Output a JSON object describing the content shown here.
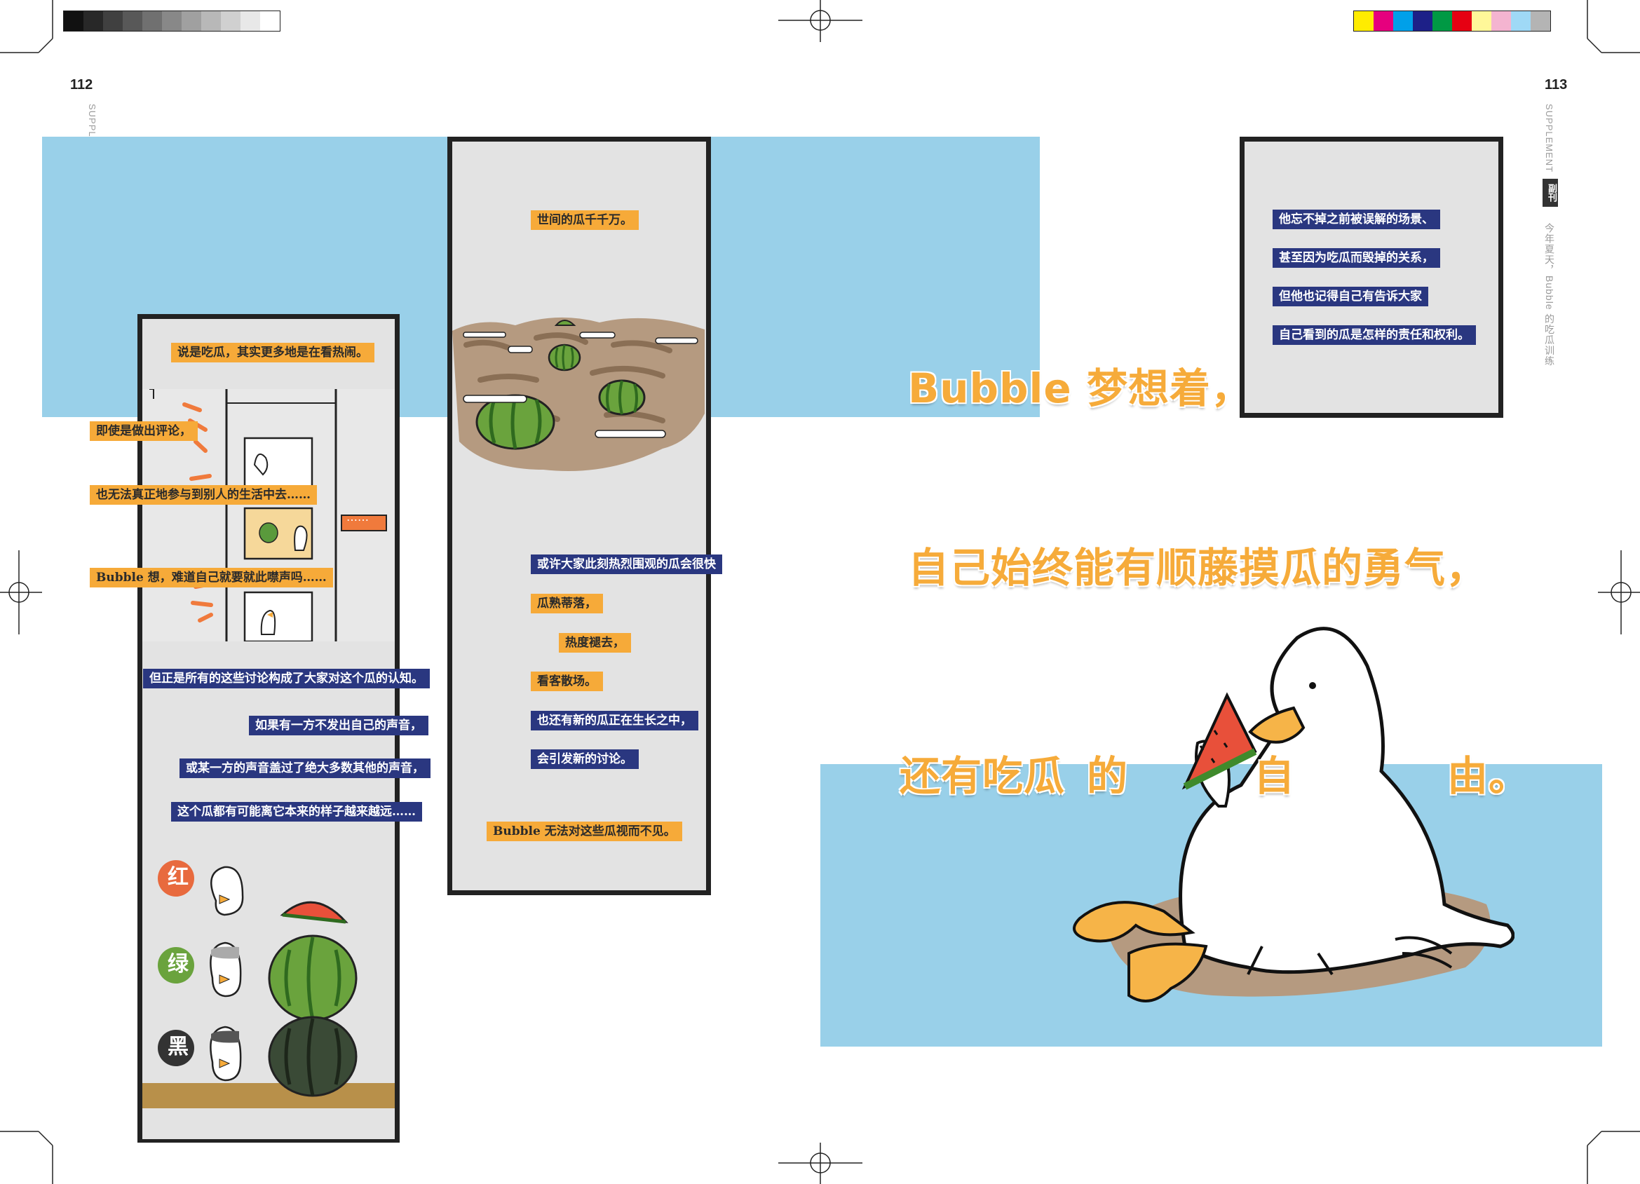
{
  "pages": {
    "left_number": "112",
    "right_number": "113"
  },
  "sidebar": {
    "supplement": "SUPPLEMENT",
    "seal": "副刊",
    "subtitle": "今年夏天，Bubble 的吃瓜训练"
  },
  "colors": {
    "sky": "#99d0e9",
    "orange_label": "#f6aa39",
    "navy_label": "#2a3780",
    "panel_bg": "#e3e3e3",
    "panel_border": "#222222",
    "headline": "#f6ab3a",
    "left_greys": [
      "#111111",
      "#282828",
      "#404040",
      "#585858",
      "#707070",
      "#888888",
      "#a0a0a0",
      "#b8b8b8",
      "#d0d0d0",
      "#e8e8e8",
      "#ffffff"
    ],
    "right_swatches": [
      "#ffec00",
      "#e6007e",
      "#00a0e9",
      "#1d2088",
      "#009944",
      "#e60012",
      "#fff799",
      "#f4b4d0",
      "#9fd9f6",
      "#b4b4b4"
    ]
  },
  "panel1": {
    "labels": [
      "说是吃瓜，其实更多地是在看热闹。",
      "即使是做出评论，",
      "也无法真正地参与到别人的生活中去……",
      "Bubble 想，难道自己就要就此噤声吗……",
      "但正是所有的这些讨论构成了大家对这个瓜的认知。",
      "如果有一方不发出自己的声音，",
      "或某一方的声音盖过了绝大多数其他的声音，",
      "这个瓜都有可能离它本来的样子越来越远……"
    ],
    "speech_bubble": "……",
    "badges": [
      "红",
      "绿",
      "黑"
    ]
  },
  "panel2": {
    "labels": [
      "世间的瓜千千万。",
      "或许大家此刻热烈围观的瓜会很快",
      "瓜熟蒂落，",
      "热度褪去，",
      "看客散场。",
      "也还有新的瓜正在生长之中，",
      "会引发新的讨论。",
      "Bubble 无法对这些瓜视而不见。"
    ]
  },
  "panel3": {
    "labels": [
      "他忘不掉之前被误解的场景、",
      "甚至因为吃瓜而毁掉的关系，",
      "但他也记得自己有告诉大家",
      "自己看到的瓜是怎样的责任和权利。"
    ]
  },
  "headline": {
    "line1": "Bubble 梦想着，",
    "line2": "自己始终能有顺藤摸瓜的勇气，",
    "line3_a": "还有吃瓜",
    "line3_b": "的",
    "line3_c": "自",
    "line3_d": "由。"
  }
}
